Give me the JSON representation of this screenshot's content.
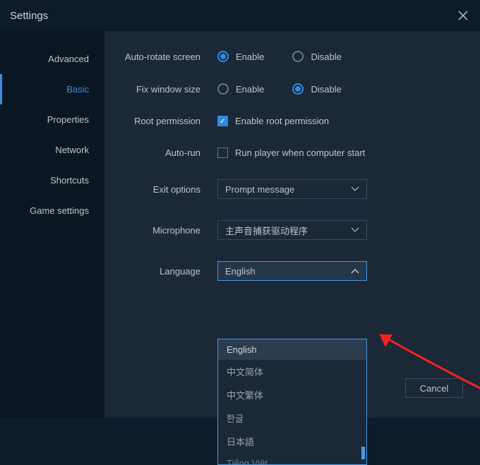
{
  "window": {
    "title": "Settings"
  },
  "sidebar": {
    "items": [
      {
        "label": "Advanced"
      },
      {
        "label": "Basic"
      },
      {
        "label": "Properties"
      },
      {
        "label": "Network"
      },
      {
        "label": "Shortcuts"
      },
      {
        "label": "Game settings"
      }
    ],
    "active_index": 1
  },
  "settings": {
    "auto_rotate": {
      "label": "Auto-rotate screen",
      "enable": "Enable",
      "disable": "Disable",
      "value": "enable"
    },
    "window_size": {
      "label": "Fix window size",
      "enable": "Enable",
      "disable": "Disable",
      "value": "disable"
    },
    "root": {
      "label": "Root permission",
      "text": "Enable root permission",
      "checked": true
    },
    "autorun": {
      "label": "Auto-run",
      "text": "Run player when computer start",
      "checked": false
    },
    "exit": {
      "label": "Exit options",
      "value": "Prompt message"
    },
    "mic": {
      "label": "Microphone",
      "value": "主声音捕获驱动程序"
    },
    "lang": {
      "label": "Language",
      "value": "English",
      "open": true,
      "options": [
        "English",
        "中文简体",
        "中文繁体",
        "한글",
        "日本語",
        "Tiếng Việt"
      ]
    }
  },
  "buttons": {
    "cancel": "Cancel"
  }
}
